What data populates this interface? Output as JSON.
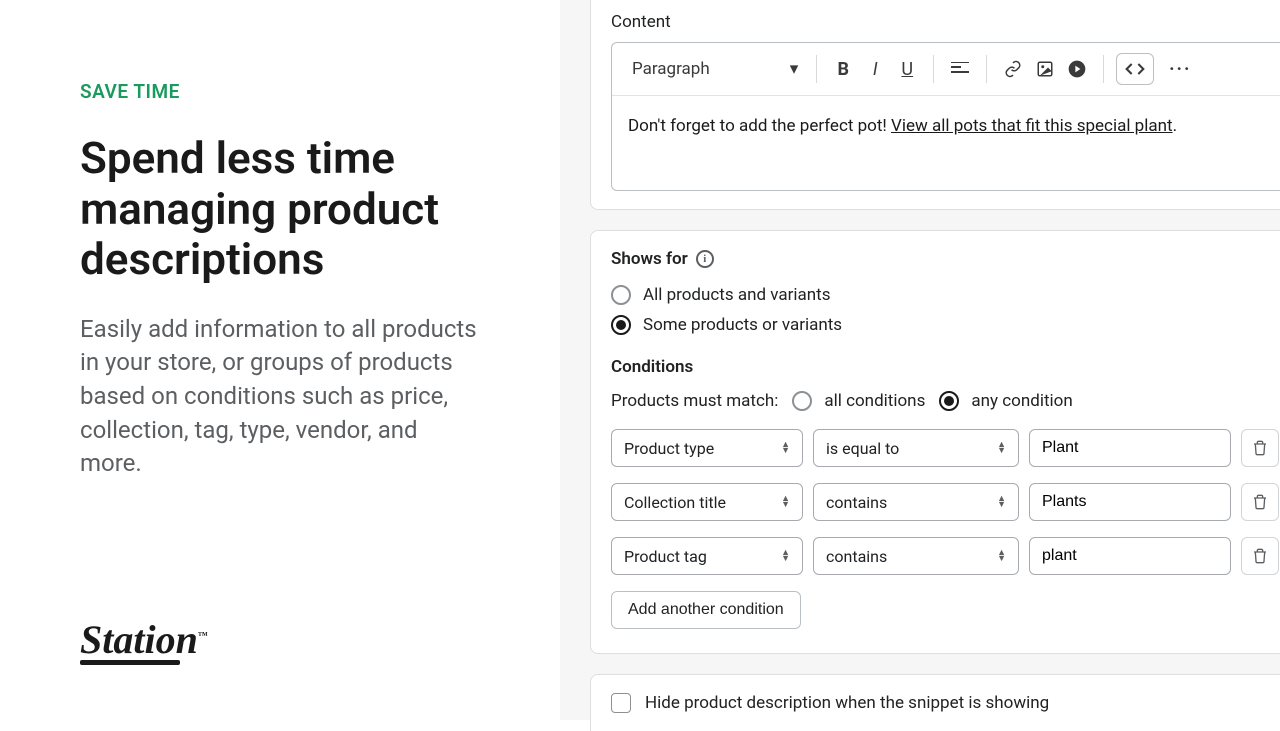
{
  "left": {
    "eyebrow": "SAVE TIME",
    "headline": "Spend less time managing product descriptions",
    "body": "Easily add information to all products in your store, or groups of products based on conditions such as price, collection, tag, type, vendor, and more.",
    "logo": "Station"
  },
  "editor": {
    "content_label": "Content",
    "format": "Paragraph",
    "body_prefix": "Don't forget to add the perfect pot! ",
    "body_link": "View all pots that fit this special plant",
    "body_suffix": "."
  },
  "shows_for": {
    "title": "Shows for",
    "options": {
      "all": "All products and variants",
      "some": "Some products or variants"
    },
    "selected": "some"
  },
  "conditions": {
    "label": "Conditions",
    "match_prefix": "Products must match:",
    "match_all": "all conditions",
    "match_any": "any condition",
    "match_selected": "any",
    "rows": [
      {
        "field": "Product type",
        "op": "is equal to",
        "value": "Plant"
      },
      {
        "field": "Collection title",
        "op": "contains",
        "value": "Plants"
      },
      {
        "field": "Product tag",
        "op": "contains",
        "value": "plant"
      }
    ],
    "add_label": "Add another condition",
    "hide_label": "Hide product description when the snippet is showing"
  }
}
